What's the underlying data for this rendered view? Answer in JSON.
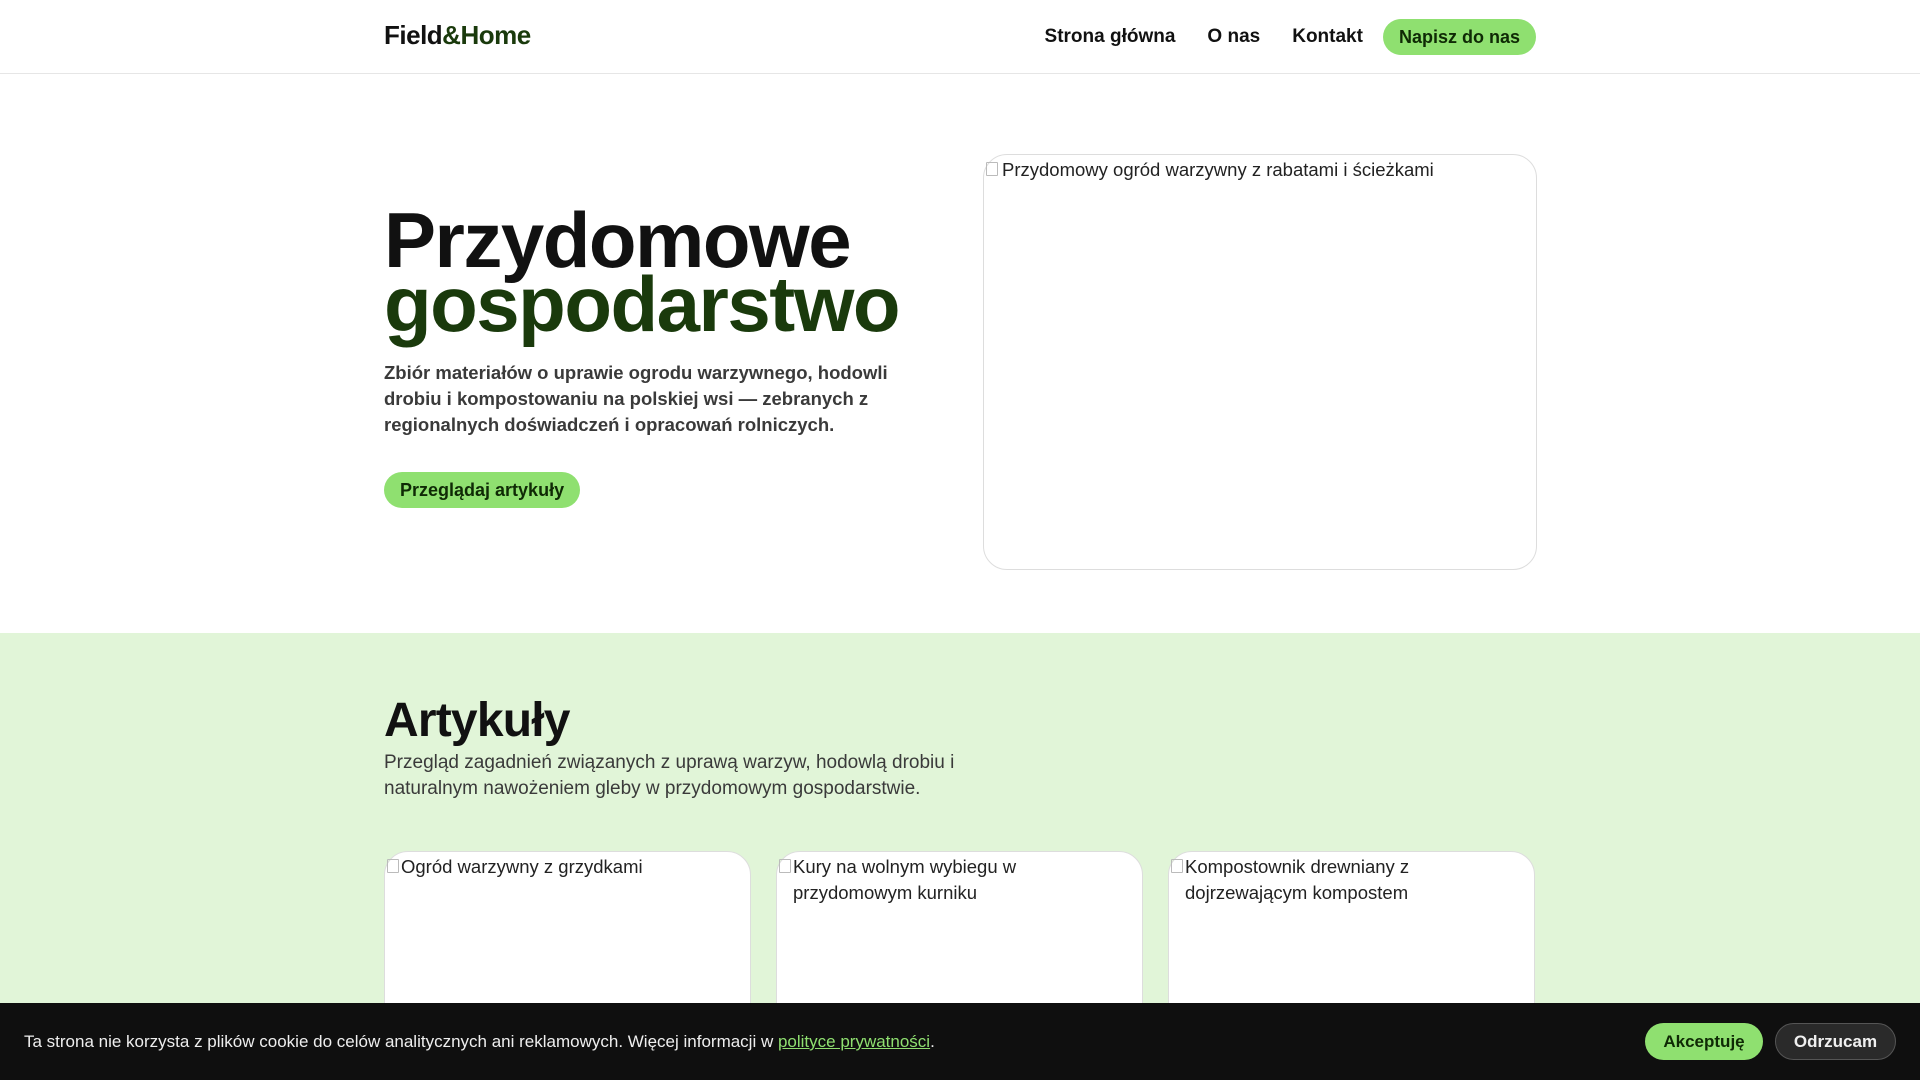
{
  "header": {
    "logo_field": "Field",
    "logo_amp_home": "&Home",
    "nav": {
      "home": "Strona główna",
      "about": "O nas",
      "contact": "Kontakt",
      "cta": "Napisz do nas"
    }
  },
  "hero": {
    "title_line1": "Przydomowe",
    "title_line2": "gospodarstwo",
    "description": "Zbiór materiałów o uprawie ogrodu warzywnego, hodowli drobiu i kompostowaniu na polskiej wsi — zebranych z regionalnych doświadczeń i opracowań rolniczych.",
    "button": "Przeglądaj artykuły",
    "image_alt": "Przydomowy ogród warzywny z rabatami i ścieżkami"
  },
  "articles": {
    "title": "Artykuły",
    "description": "Przegląd zagadnień związanych z uprawą warzyw, hodowlą drobiu i naturalnym nawożeniem gleby w przydomowym gospodarstwie.",
    "cards": [
      {
        "image_alt": "Ogród warzywny z grzydkami"
      },
      {
        "image_alt": "Kury na wolnym wybiegu w przydomowym kurniku"
      },
      {
        "image_alt": "Kompostownik drewniany z dojrzewającym kompostem"
      }
    ]
  },
  "cookie": {
    "text": "Ta strona nie korzysta z plików cookie do celów analitycznych ani reklamowych. Więcej informacji w ",
    "link": "polityce prywatności",
    "suffix": ".",
    "accept": "Akceptuję",
    "reject": "Odrzucam"
  },
  "colors": {
    "accent": "#8fe070",
    "dark_green": "#1a3a0c",
    "section_bg": "#e1f5d8",
    "cookie_bg": "#0f0f0f"
  }
}
